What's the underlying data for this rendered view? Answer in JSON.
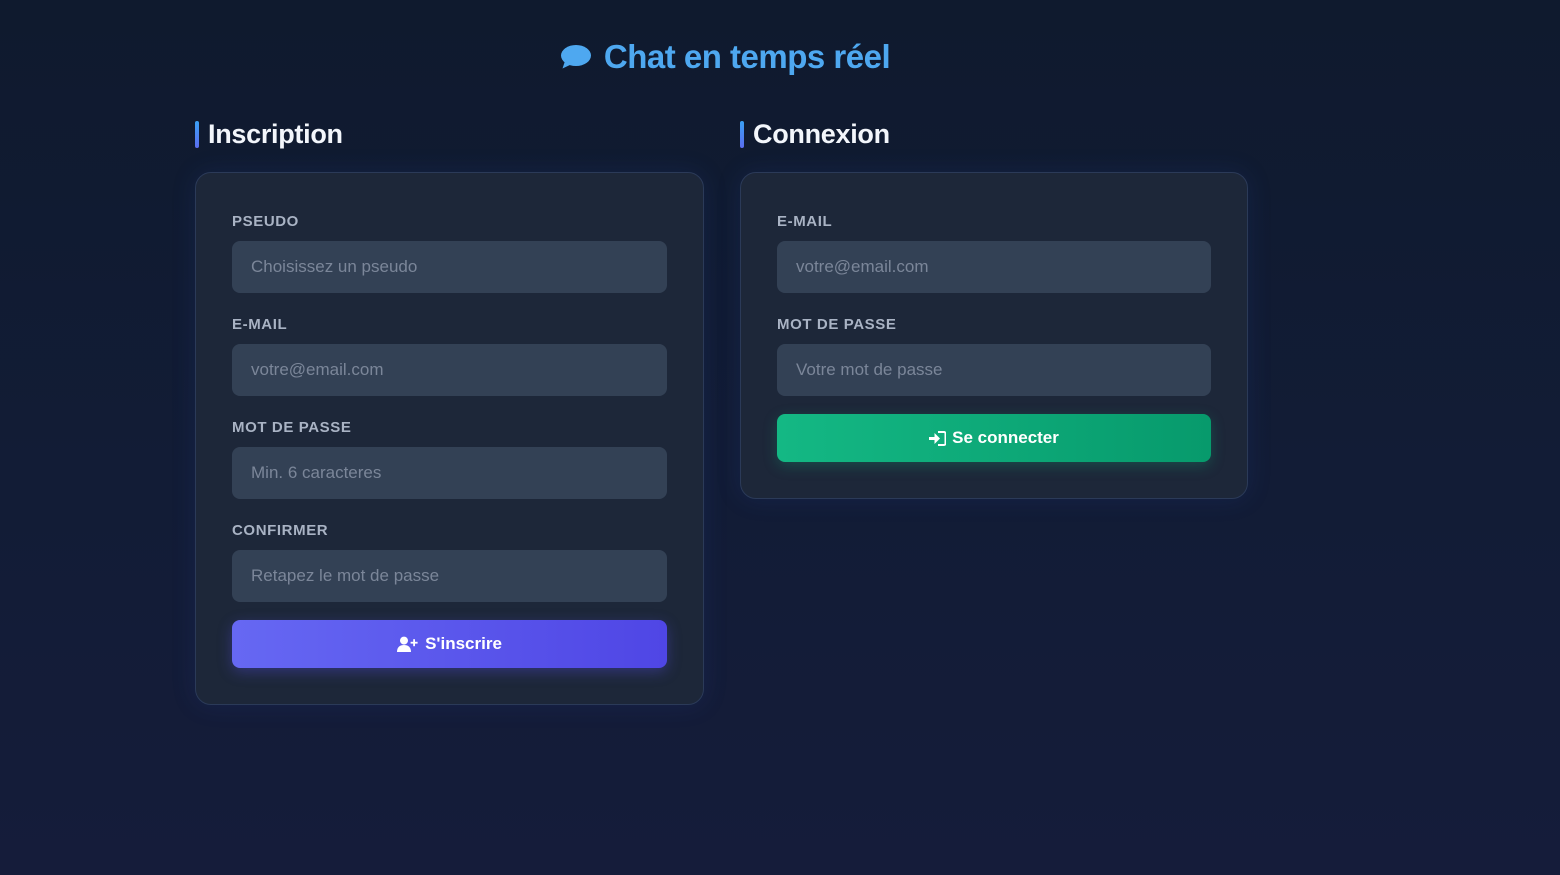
{
  "header": {
    "icon": "chat-bubble-icon",
    "title": "Chat en temps réel"
  },
  "signup": {
    "title": "Inscription",
    "fields": [
      {
        "label": "PSEUDO",
        "placeholder": "Choisissez un pseudo",
        "value": ""
      },
      {
        "label": "E-MAIL",
        "placeholder": "votre@email.com",
        "value": ""
      },
      {
        "label": "MOT DE PASSE",
        "placeholder": "Min. 6 caracteres",
        "value": ""
      },
      {
        "label": "CONFIRMER",
        "placeholder": "Retapez le mot de passe",
        "value": ""
      }
    ],
    "button": {
      "icon": "user-plus-icon",
      "label": "S'inscrire"
    }
  },
  "login": {
    "title": "Connexion",
    "fields": [
      {
        "label": "E-MAIL",
        "placeholder": "votre@email.com",
        "value": ""
      },
      {
        "label": "MOT DE PASSE",
        "placeholder": "Votre mot de passe",
        "value": ""
      }
    ],
    "button": {
      "icon": "sign-in-icon",
      "label": "Se connecter"
    }
  },
  "colors": {
    "accent": "#4ea8f0",
    "signup_button": "#5b5cf0",
    "login_button": "#10b07c",
    "card_background": "#1d2739",
    "input_background": "#334155"
  }
}
